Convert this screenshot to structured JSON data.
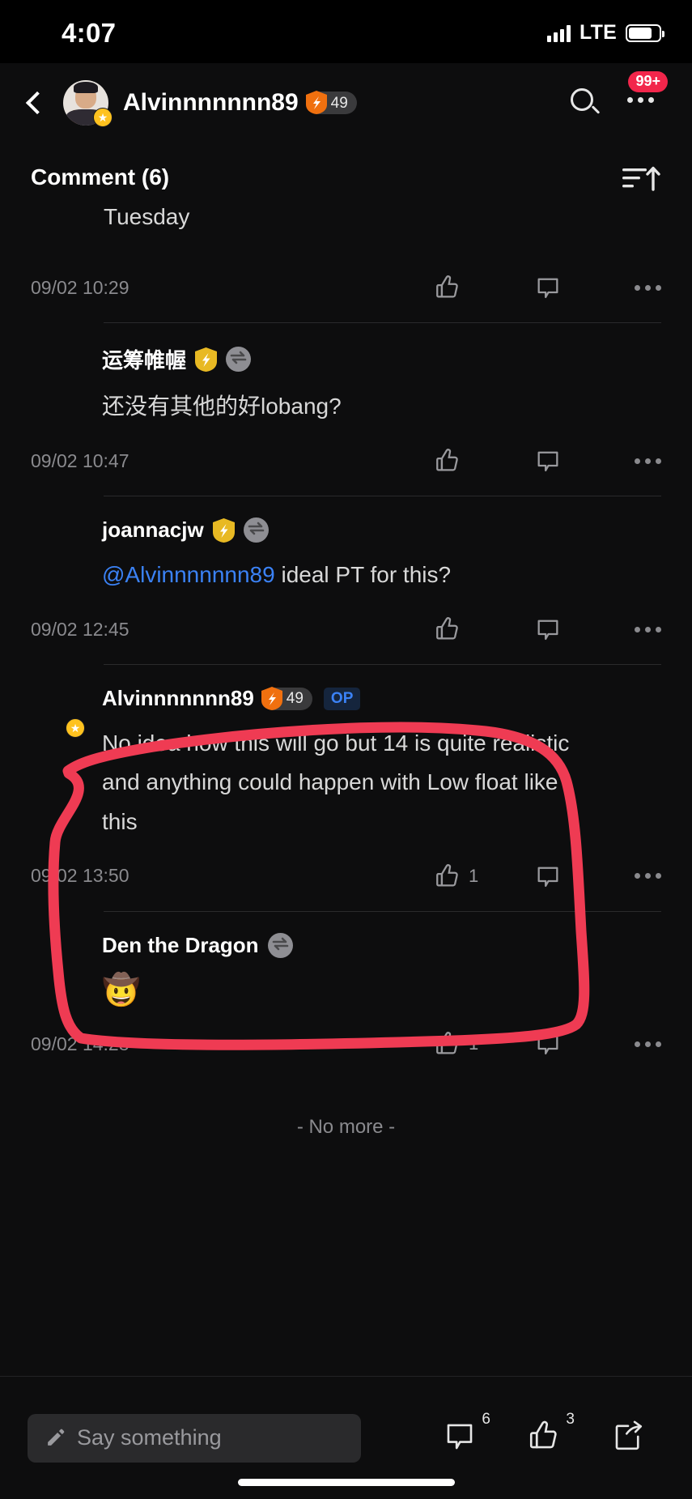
{
  "status_bar": {
    "time": "4:07",
    "network": "LTE"
  },
  "nav": {
    "back_icon": "chevron-left-icon",
    "user_name": "Alvinnnnnnn89",
    "level_badge": "49",
    "search_icon": "search-icon",
    "more_icon": "more-horizontal-icon",
    "notification_count": "99+"
  },
  "comment_header": {
    "title": "Comment (6)",
    "sort_icon": "sort-ascending-icon"
  },
  "comments": [
    {
      "id": "c0",
      "partial": true,
      "text": "Tuesday",
      "time": "09/02 10:29",
      "like_count": "",
      "avatar_art": "none"
    },
    {
      "id": "c1",
      "name": "运筹帷幄",
      "badges": [
        "gold-shield",
        "gray-lightning"
      ],
      "text": "还没有其他的好lobang?",
      "time": "09/02 10:47",
      "like_count": "",
      "avatar_art": "art-car"
    },
    {
      "id": "c2",
      "name": "joannacjw",
      "badges": [
        "gold-shield",
        "gray-lightning"
      ],
      "mention": "@Alvinnnnnnn89",
      "text": " ideal PT for this?",
      "time": "09/02 12:45",
      "like_count": "",
      "avatar_art": "art-cow"
    },
    {
      "id": "c3",
      "name": "Alvinnnnnnn89",
      "badges": [
        "orange-shield-49",
        "op"
      ],
      "level_badge": "49",
      "op_label": "OP",
      "text": "No idea how this will go but 14 is quite realistic and anything could happen with Low float like this",
      "time": "09/02 13:50",
      "like_count": "1",
      "avatar_art": "art-alvin",
      "highlighted": true
    },
    {
      "id": "c4",
      "name": "Den the Dragon",
      "badges": [
        "gray-lightning"
      ],
      "text": "🤠",
      "is_emoji": true,
      "time": "09/02 14:28",
      "like_count": "1",
      "avatar_art": "art-den"
    }
  ],
  "footer": {
    "no_more": "- No more -"
  },
  "bottom_bar": {
    "input_placeholder": "Say something",
    "pencil_icon": "pencil-icon",
    "comment_icon": "comment-bubble-icon",
    "comment_count": "6",
    "like_icon": "thumbs-up-icon",
    "like_count": "3",
    "share_icon": "share-icon"
  },
  "annotation": {
    "type": "hand-drawn-circle",
    "color": "#ef3b53",
    "target": "Alvinnnnnnn89 comment"
  },
  "colors": {
    "background": "#0d0d0e",
    "accent_blue": "#3b82f6",
    "badge_red": "#f2264b",
    "annotation_red": "#ef3b53",
    "gold": "#e8b923",
    "orange": "#f0700f"
  }
}
